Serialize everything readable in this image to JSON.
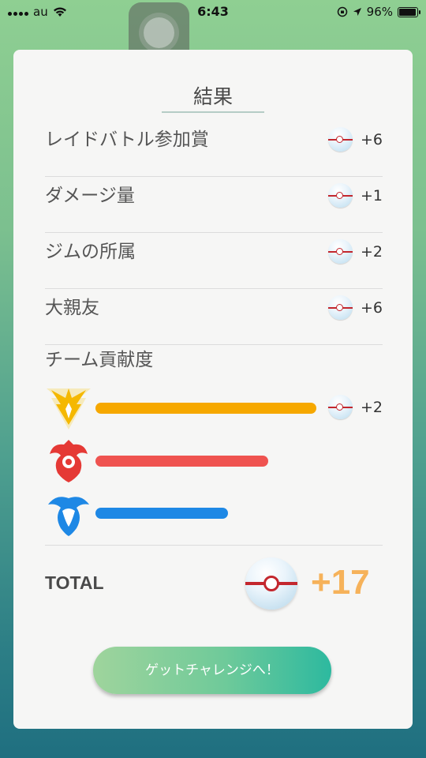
{
  "status_bar": {
    "carrier": "au",
    "time": "6:43",
    "battery": "96%"
  },
  "title": "結果",
  "rows": [
    {
      "label": "レイドバトル参加賞",
      "count": "+6"
    },
    {
      "label": "ダメージ量",
      "count": "+1"
    },
    {
      "label": "ジムの所属",
      "count": "+2"
    },
    {
      "label": "大親友",
      "count": "+6"
    }
  ],
  "team_contribution": {
    "label": "チーム貢献度",
    "teams": [
      {
        "team": "instinct",
        "color": "#f6a800",
        "fill": 0.65,
        "count": "+2",
        "icon": "zapdos-icon"
      },
      {
        "team": "valor",
        "color": "#ef5350",
        "fill": 0.51,
        "icon": "moltres-icon"
      },
      {
        "team": "mystic",
        "color": "#1e88e5",
        "fill": 0.39,
        "icon": "articuno-icon"
      }
    ]
  },
  "total": {
    "label": "TOTAL",
    "value": "+17"
  },
  "cta_label": "ゲットチャレンジへ！",
  "colors": {
    "accent_orange": "#f6b25a",
    "ball_red": "#c3272e"
  }
}
